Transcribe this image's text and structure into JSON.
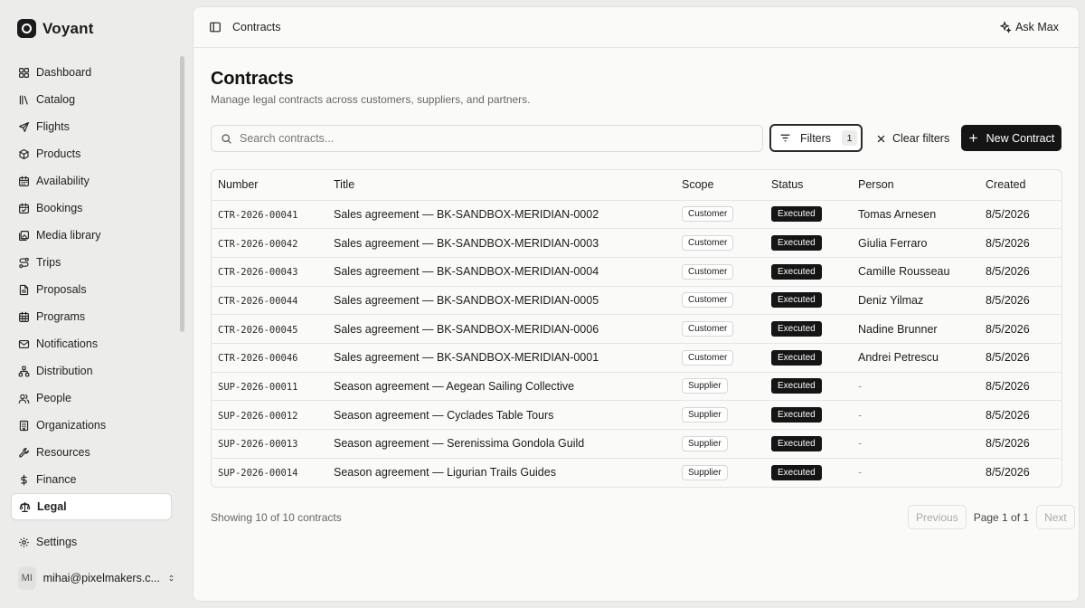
{
  "brand": {
    "name": "Voyant"
  },
  "sidebar": {
    "items": [
      {
        "label": "Dashboard",
        "icon": "dashboard-icon"
      },
      {
        "label": "Catalog",
        "icon": "catalog-icon"
      },
      {
        "label": "Flights",
        "icon": "plane-icon"
      },
      {
        "label": "Products",
        "icon": "package-icon"
      },
      {
        "label": "Availability",
        "icon": "calendar-icon"
      },
      {
        "label": "Bookings",
        "icon": "calendar-check-icon"
      },
      {
        "label": "Media library",
        "icon": "images-icon"
      },
      {
        "label": "Trips",
        "icon": "route-icon"
      },
      {
        "label": "Proposals",
        "icon": "file-text-icon"
      },
      {
        "label": "Programs",
        "icon": "calendar-days-icon"
      },
      {
        "label": "Notifications",
        "icon": "mail-icon"
      },
      {
        "label": "Distribution",
        "icon": "network-icon"
      },
      {
        "label": "People",
        "icon": "users-icon"
      },
      {
        "label": "Organizations",
        "icon": "building-icon"
      },
      {
        "label": "Resources",
        "icon": "wrench-icon"
      },
      {
        "label": "Finance",
        "icon": "dollar-icon"
      },
      {
        "label": "Legal",
        "icon": "scale-icon",
        "active": true
      }
    ],
    "settings_label": "Settings"
  },
  "user": {
    "initials": "MI",
    "email": "mihai@pixelmakers.c..."
  },
  "topbar": {
    "breadcrumb": "Contracts",
    "ask_label": "Ask Max"
  },
  "page": {
    "title": "Contracts",
    "subtitle": "Manage legal contracts across customers, suppliers, and partners."
  },
  "search": {
    "placeholder": "Search contracts...",
    "value": ""
  },
  "toolbar": {
    "filters_label": "Filters",
    "filters_count": "1",
    "clear_label": "Clear filters",
    "new_label": "New Contract"
  },
  "table": {
    "columns": [
      "Number",
      "Title",
      "Scope",
      "Status",
      "Person",
      "Created"
    ],
    "rows": [
      {
        "number": "CTR-2026-00041",
        "title": "Sales agreement — BK-SANDBOX-MERIDIAN-0002",
        "scope": "Customer",
        "status": "Executed",
        "person": "Tomas Arnesen",
        "created": "8/5/2026"
      },
      {
        "number": "CTR-2026-00042",
        "title": "Sales agreement — BK-SANDBOX-MERIDIAN-0003",
        "scope": "Customer",
        "status": "Executed",
        "person": "Giulia Ferraro",
        "created": "8/5/2026"
      },
      {
        "number": "CTR-2026-00043",
        "title": "Sales agreement — BK-SANDBOX-MERIDIAN-0004",
        "scope": "Customer",
        "status": "Executed",
        "person": "Camille Rousseau",
        "created": "8/5/2026"
      },
      {
        "number": "CTR-2026-00044",
        "title": "Sales agreement — BK-SANDBOX-MERIDIAN-0005",
        "scope": "Customer",
        "status": "Executed",
        "person": "Deniz Yilmaz",
        "created": "8/5/2026"
      },
      {
        "number": "CTR-2026-00045",
        "title": "Sales agreement — BK-SANDBOX-MERIDIAN-0006",
        "scope": "Customer",
        "status": "Executed",
        "person": "Nadine Brunner",
        "created": "8/5/2026"
      },
      {
        "number": "CTR-2026-00046",
        "title": "Sales agreement — BK-SANDBOX-MERIDIAN-0001",
        "scope": "Customer",
        "status": "Executed",
        "person": "Andrei Petrescu",
        "created": "8/5/2026"
      },
      {
        "number": "SUP-2026-00011",
        "title": "Season agreement — Aegean Sailing Collective",
        "scope": "Supplier",
        "status": "Executed",
        "person": "-",
        "created": "8/5/2026"
      },
      {
        "number": "SUP-2026-00012",
        "title": "Season agreement — Cyclades Table Tours",
        "scope": "Supplier",
        "status": "Executed",
        "person": "-",
        "created": "8/5/2026"
      },
      {
        "number": "SUP-2026-00013",
        "title": "Season agreement — Serenissima Gondola Guild",
        "scope": "Supplier",
        "status": "Executed",
        "person": "-",
        "created": "8/5/2026"
      },
      {
        "number": "SUP-2026-00014",
        "title": "Season agreement — Ligurian Trails Guides",
        "scope": "Supplier",
        "status": "Executed",
        "person": "-",
        "created": "8/5/2026"
      }
    ]
  },
  "footer": {
    "showing": "Showing 10 of 10 contracts",
    "previous_label": "Previous",
    "page_label": "Page 1 of 1",
    "next_label": "Next"
  }
}
